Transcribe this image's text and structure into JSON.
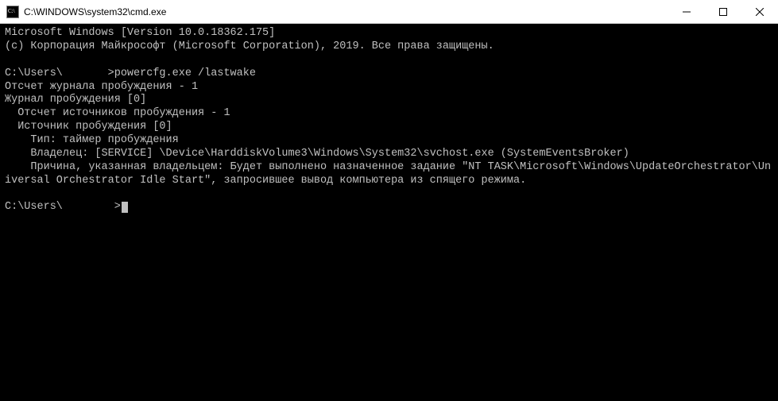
{
  "titlebar": {
    "title": "C:\\WINDOWS\\system32\\cmd.exe"
  },
  "terminal": {
    "lines": [
      "Microsoft Windows [Version 10.0.18362.175]",
      "(c) Корпорация Майкрософт (Microsoft Corporation), 2019. Все права защищены.",
      "",
      "C:\\Users\\       >powercfg.exe /lastwake",
      "Отсчет журнала пробуждения - 1",
      "Журнал пробуждения [0]",
      "  Отсчет источников пробуждения - 1",
      "  Источник пробуждения [0]",
      "    Тип: таймер пробуждения",
      "    Владелец: [SERVICE] \\Device\\HarddiskVolume3\\Windows\\System32\\svchost.exe (SystemEventsBroker)",
      "    Причина, указанная владельцем: Будет выполнено назначенное задание \"NT TASK\\Microsoft\\Windows\\UpdateOrchestrator\\Universal Orchestrator Idle Start\", запросившее вывод компьютера из спящего режима.",
      ""
    ],
    "prompt": "C:\\Users\\        >"
  }
}
